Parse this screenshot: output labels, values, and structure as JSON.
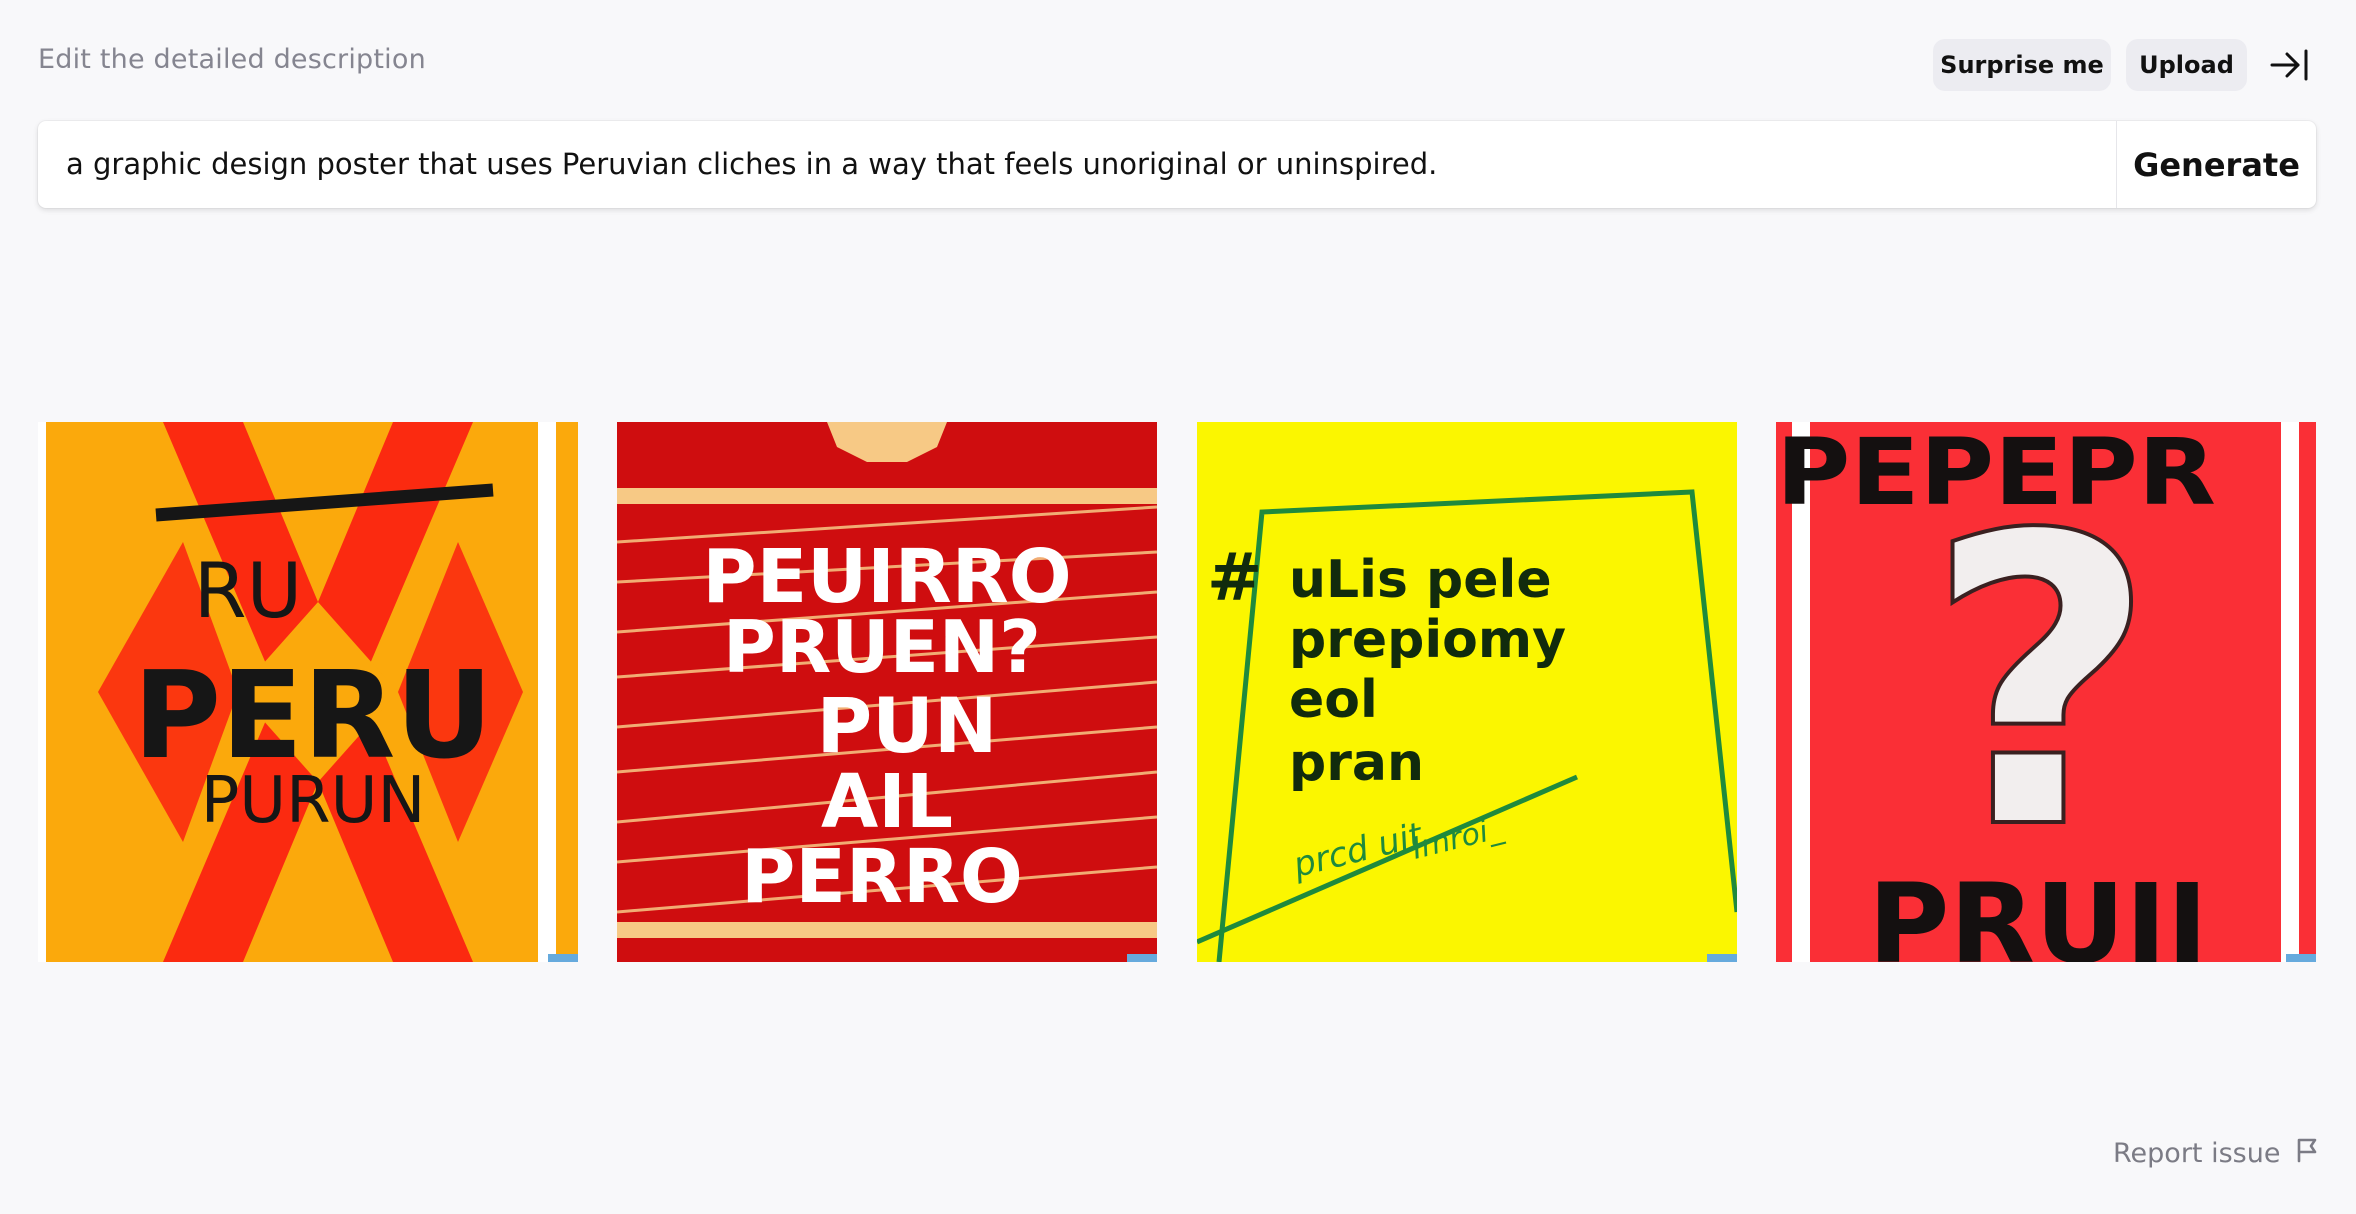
{
  "header": {
    "hint": "Edit the detailed description",
    "surprise_label": "Surprise me",
    "upload_label": "Upload",
    "collapse_icon": "arrow-to-right-icon"
  },
  "prompt": {
    "value": "a graphic design poster that uses Peruvian cliches in a way that feels unoriginal or uninspired.",
    "generate_label": "Generate"
  },
  "images": [
    {
      "lines": [
        "RU",
        "PERU",
        "PURUN"
      ],
      "palette": {
        "bg": "#fba90c",
        "accent": "#fb2a10",
        "ink": "#161616"
      }
    },
    {
      "lines": [
        "PEUIRRO",
        "PRUEN?",
        "PUN",
        "AIL",
        "PERRO"
      ],
      "palette": {
        "bg": "#cf0d0f",
        "accent": "#f7c985",
        "ink": "#ffffff"
      }
    },
    {
      "lines": [
        "#",
        "uLis pele",
        "prepiomy",
        "eol",
        "pran",
        "prcd uit",
        "Imroi_"
      ],
      "palette": {
        "bg": "#fbf600",
        "accent": "#1f8a3d",
        "ink": "#112b0d"
      }
    },
    {
      "lines": [
        "PEPEPR",
        "?",
        "PRUII"
      ],
      "palette": {
        "bg": "#fa2f36",
        "accent": "#ffffff",
        "ink": "#141010"
      }
    }
  ],
  "footer": {
    "report_label": "Report issue",
    "report_icon": "flag-icon"
  }
}
